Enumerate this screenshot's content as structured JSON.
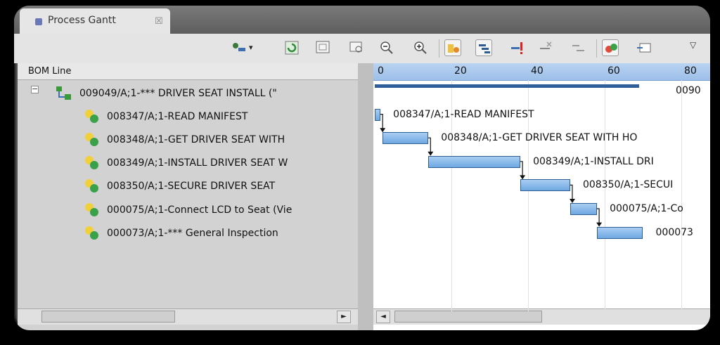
{
  "tab": {
    "title": "Process Gantt",
    "close": "☒"
  },
  "toolbar": {
    "dropdown": "▾",
    "menu": "▽"
  },
  "tree": {
    "column_header": "BOM Line",
    "expander": "−",
    "rows": [
      {
        "label": "009049/A;1-*** DRIVER SEAT INSTALL (\"",
        "icon": "process-structure-icon"
      },
      {
        "label": "008347/A;1-READ MANIFEST",
        "icon": "operation-icon"
      },
      {
        "label": "008348/A;1-GET DRIVER SEAT WITH",
        "icon": "operation-icon"
      },
      {
        "label": "008349/A;1-INSTALL DRIVER SEAT W",
        "icon": "operation-icon"
      },
      {
        "label": "008350/A;1-SECURE DRIVER SEAT",
        "icon": "operation-icon"
      },
      {
        "label": "000075/A;1-Connect LCD to Seat (Vie",
        "icon": "operation-icon"
      },
      {
        "label": "000073/A;1-*** General Inspection",
        "icon": "operation-icon"
      }
    ]
  },
  "gantt": {
    "ticks": [
      "0",
      "20",
      "40",
      "60",
      "80"
    ],
    "tasks": [
      {
        "start": 0,
        "end": 69,
        "summary": true,
        "label": "0090"
      },
      {
        "start": 0,
        "end": 1.5,
        "label": "008347/A;1-READ MANIFEST"
      },
      {
        "start": 2,
        "end": 14,
        "label": "008348/A;1-GET DRIVER SEAT WITH HO"
      },
      {
        "start": 14,
        "end": 38,
        "label": "008349/A;1-INSTALL DRI"
      },
      {
        "start": 38,
        "end": 51,
        "label": "008350/A;1-SECUI"
      },
      {
        "start": 51,
        "end": 58,
        "label": "000075/A;1-Co"
      },
      {
        "start": 58,
        "end": 70,
        "label": "000073"
      }
    ]
  },
  "scroll": {
    "left_arrow": "◄",
    "right_arrow": "►"
  },
  "colors": {
    "bar_fill": "#8bbcec",
    "bar_border": "#2e5d94",
    "header_blue": "#a9c9ee"
  }
}
